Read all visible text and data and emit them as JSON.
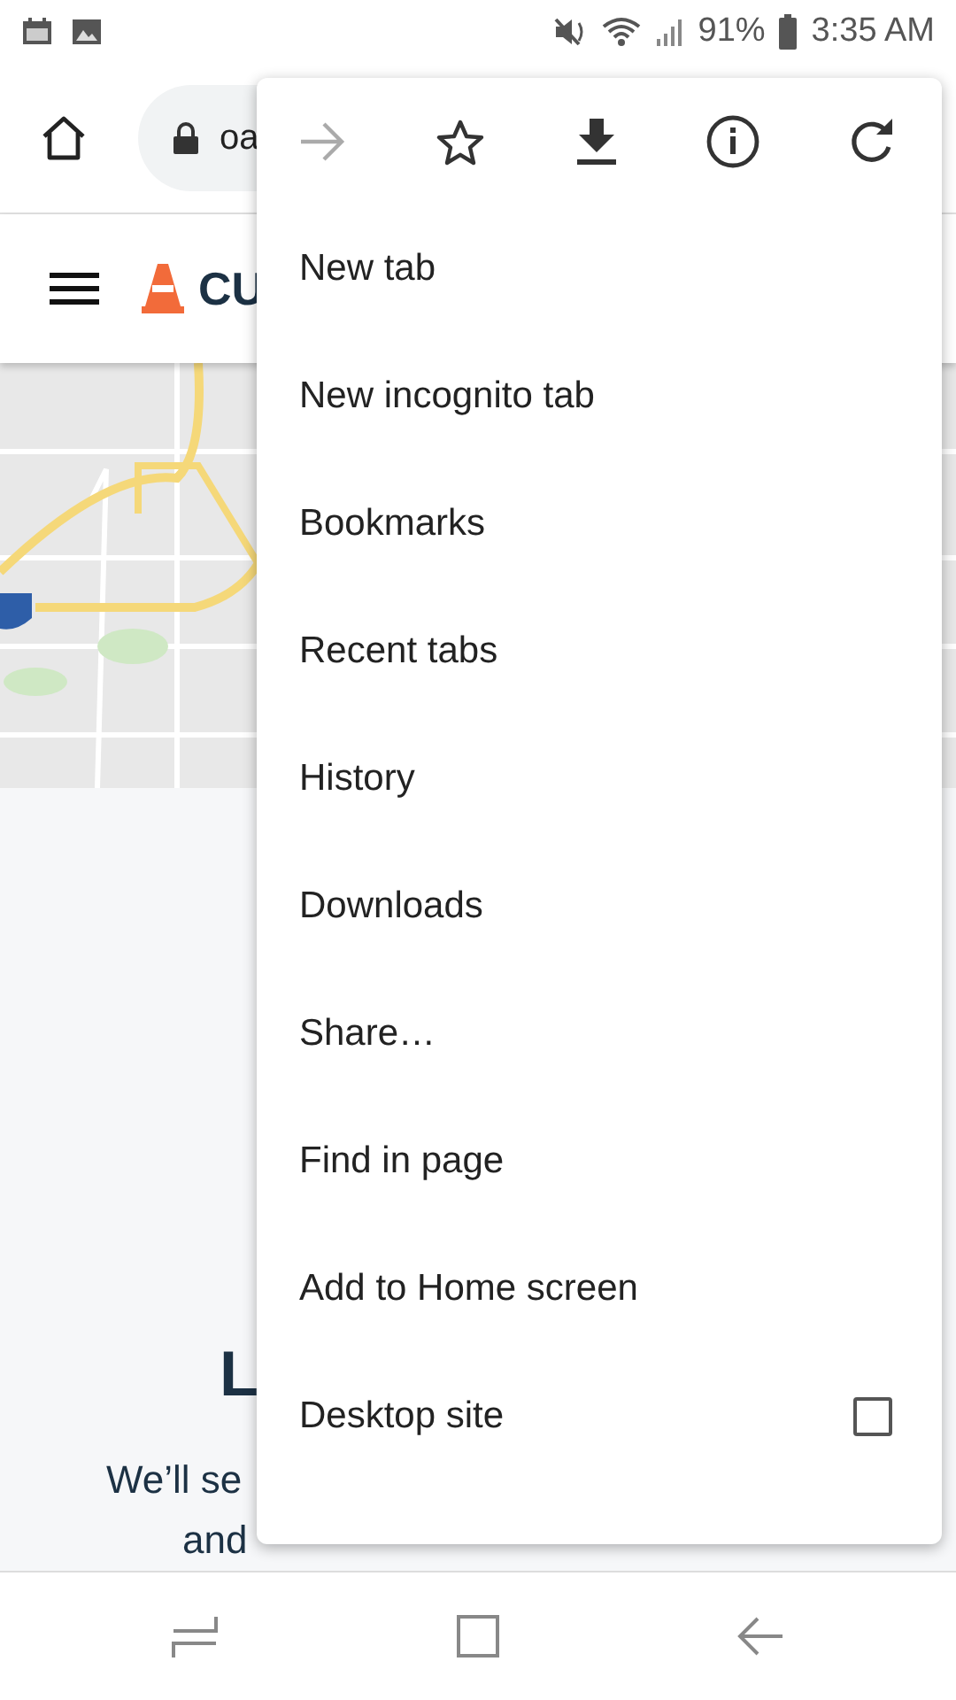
{
  "status_bar": {
    "battery": "91%",
    "time": "3:35 AM"
  },
  "toolbar": {
    "url": "oa"
  },
  "site": {
    "logo": "CU",
    "heading": "L",
    "lines": [
      "We’ll se",
      "and"
    ]
  },
  "menu": {
    "icons": [
      {
        "kind": "forward",
        "disabled": true
      },
      {
        "kind": "star",
        "disabled": false
      },
      {
        "kind": "download",
        "disabled": false
      },
      {
        "kind": "info",
        "disabled": false
      },
      {
        "kind": "reload",
        "disabled": false
      }
    ],
    "items": [
      {
        "kind": "item",
        "label": "New tab"
      },
      {
        "kind": "item",
        "label": "New incognito tab"
      },
      {
        "kind": "item",
        "label": "Bookmarks"
      },
      {
        "kind": "item",
        "label": "Recent tabs"
      },
      {
        "kind": "item",
        "label": "History"
      },
      {
        "kind": "item",
        "label": "Downloads"
      },
      {
        "kind": "item",
        "label": "Share…"
      },
      {
        "kind": "item",
        "label": "Find in page"
      },
      {
        "kind": "item",
        "label": "Add to Home screen"
      },
      {
        "kind": "checkbox",
        "label": "Desktop site",
        "checked": false
      }
    ]
  }
}
